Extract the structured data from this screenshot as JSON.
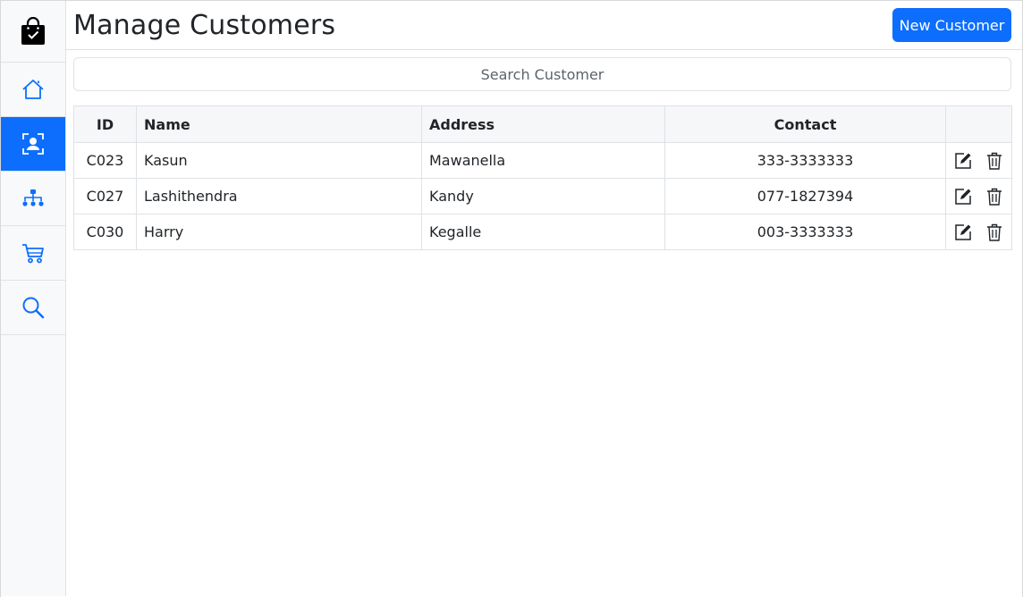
{
  "header": {
    "title": "Manage Customers",
    "new_button_label": "New Customer"
  },
  "search": {
    "placeholder": "Search Customer"
  },
  "sidebar": {
    "items": [
      {
        "icon": "shopping-bag-check-icon"
      },
      {
        "icon": "home-icon"
      },
      {
        "icon": "customer-badge-icon",
        "active": true
      },
      {
        "icon": "sitemap-icon"
      },
      {
        "icon": "cart-icon"
      },
      {
        "icon": "search-icon"
      }
    ]
  },
  "table": {
    "columns": [
      "ID",
      "Name",
      "Address",
      "Contact"
    ],
    "rows": [
      {
        "id": "C023",
        "name": "Kasun",
        "address": "Mawanella",
        "contact": "333-3333333"
      },
      {
        "id": "C027",
        "name": "Lashithendra",
        "address": "Kandy",
        "contact": "077-1827394"
      },
      {
        "id": "C030",
        "name": "Harry",
        "address": "Kegalle",
        "contact": "003-3333333"
      }
    ],
    "row_actions": [
      "edit-icon",
      "trash-icon"
    ]
  },
  "colors": {
    "primary": "#0d6efd",
    "sidebar_bg": "#f8f9fa",
    "border": "#dee2e6",
    "text": "#212529"
  }
}
